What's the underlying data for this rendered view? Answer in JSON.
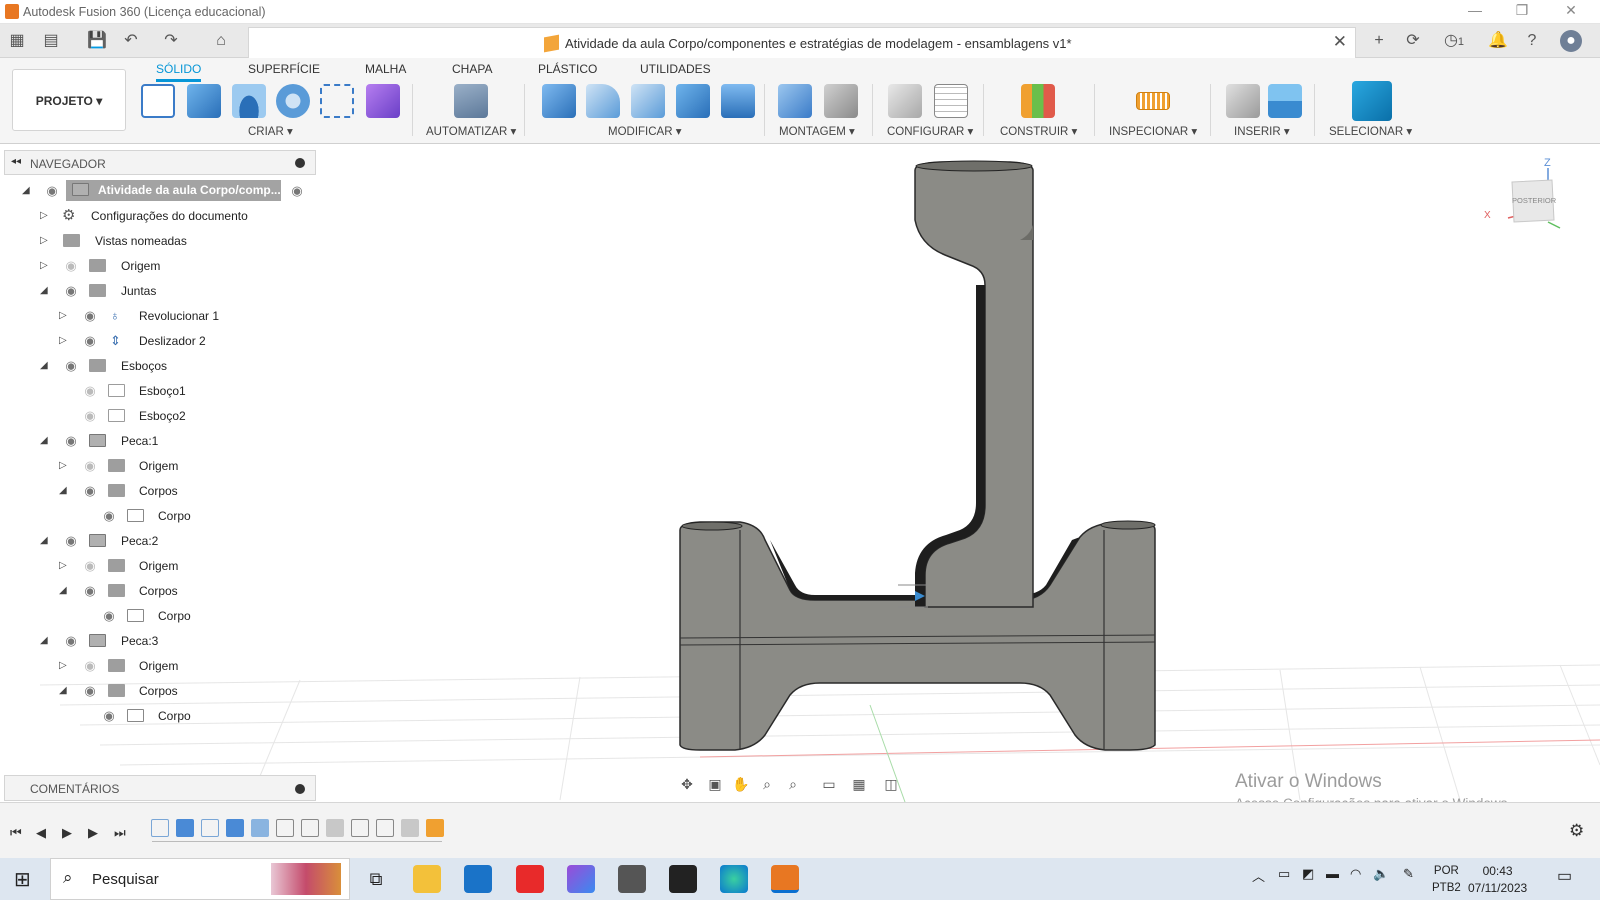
{
  "titlebar": {
    "title": "Autodesk Fusion 360 (Licença educacional)",
    "minimize_icon": "minimize-icon",
    "restore_icon": "restore-icon",
    "close_icon": "close-icon"
  },
  "document": {
    "title": "Atividade da aula Corpo/componentes e estratégias de modelagem - ensamblagens v1*",
    "close": "✕"
  },
  "quick_access": {
    "notification_count": "1"
  },
  "ribbon": {
    "project_label": "PROJETO ▾",
    "tabs": [
      "SÓLIDO",
      "SUPERFÍCIE",
      "MALHA",
      "CHAPA",
      "PLÁSTICO",
      "UTILIDADES"
    ],
    "active_tab": "SÓLIDO",
    "groups": [
      {
        "label": "CRIAR ▾"
      },
      {
        "label": "AUTOMATIZAR ▾"
      },
      {
        "label": "MODIFICAR ▾"
      },
      {
        "label": "MONTAGEM ▾"
      },
      {
        "label": "CONFIGURAR ▾"
      },
      {
        "label": "CONSTRUIR ▾"
      },
      {
        "label": "INSPECIONAR ▾"
      },
      {
        "label": "INSERIR ▾"
      },
      {
        "label": "SELECIONAR ▾"
      }
    ]
  },
  "navigator": {
    "header": "NAVEGADOR",
    "root": "Atividade da aula Corpo/comp...",
    "items": [
      {
        "label": "Configurações do documento"
      },
      {
        "label": "Vistas nomeadas"
      },
      {
        "label": "Origem"
      },
      {
        "label": "Juntas"
      },
      {
        "label": "Revolucionar 1"
      },
      {
        "label": "Deslizador 2"
      },
      {
        "label": "Esboços"
      },
      {
        "label": "Esboço1"
      },
      {
        "label": "Esboço2"
      },
      {
        "label": "Peca:1"
      },
      {
        "label": "Origem"
      },
      {
        "label": "Corpos"
      },
      {
        "label": "Corpo"
      },
      {
        "label": "Peca:2"
      },
      {
        "label": "Origem"
      },
      {
        "label": "Corpos"
      },
      {
        "label": "Corpo"
      },
      {
        "label": "Peca:3"
      },
      {
        "label": "Origem"
      },
      {
        "label": "Corpos"
      },
      {
        "label": "Corpo"
      }
    ]
  },
  "comments": {
    "header": "COMENTÁRIOS"
  },
  "viewcube": {
    "face_label": "POSTERIOR",
    "axis_z": "Z",
    "axis_x": "X"
  },
  "watermark": {
    "line1": "Ativar o Windows",
    "line2": "Acesse Configurações para ativar o Windows."
  },
  "taskbar": {
    "search_placeholder": "Pesquisar",
    "language": "POR",
    "keyboard": "PTB2",
    "time": "00:43",
    "date": "07/11/2023"
  },
  "colors": {
    "accent": "#0696d7",
    "model_body": "#8b8b86",
    "fusion_orange": "#e87722"
  }
}
